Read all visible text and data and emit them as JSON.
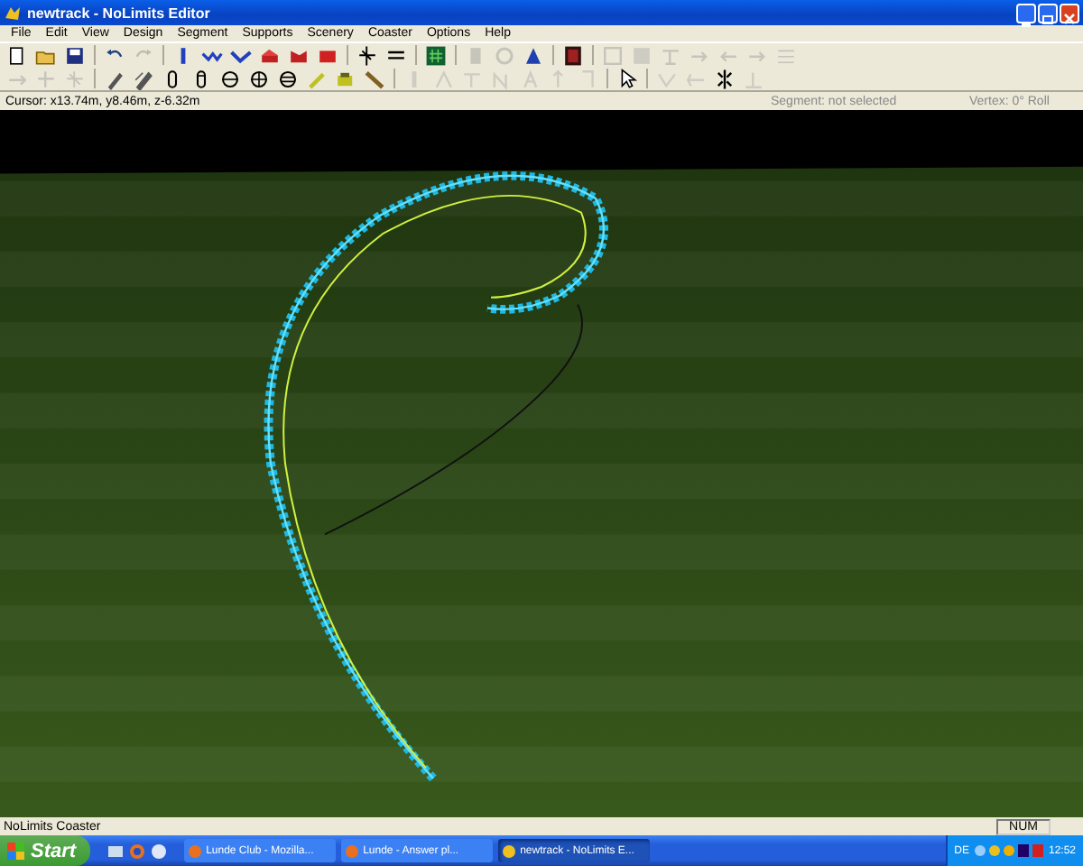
{
  "window": {
    "title": "newtrack - NoLimits Editor"
  },
  "menu": [
    "File",
    "Edit",
    "View",
    "Design",
    "Segment",
    "Supports",
    "Scenery",
    "Coaster",
    "Options",
    "Help"
  ],
  "toolbar_1": [
    {
      "disabled": false
    },
    {
      "disabled": false
    },
    {
      "disabled": false
    },
    {
      "disabled": false
    },
    {
      "disabled": true
    },
    {
      "disabled": false
    },
    {
      "disabled": false
    },
    {
      "disabled": false
    },
    {
      "disabled": false
    },
    {
      "disabled": false
    },
    {
      "disabled": false
    },
    {
      "disabled": false
    },
    {
      "disabled": false
    },
    {
      "disabled": false
    },
    {
      "disabled": true
    },
    {
      "disabled": true
    },
    {
      "disabled": false
    },
    {
      "disabled": false
    },
    {
      "disabled": true
    },
    {
      "disabled": true
    },
    {
      "disabled": true
    },
    {
      "disabled": true
    },
    {
      "disabled": true
    },
    {
      "disabled": true
    },
    {
      "disabled": true
    }
  ],
  "toolbar_2": [
    {
      "disabled": true
    },
    {
      "disabled": true
    },
    {
      "disabled": true
    },
    {
      "disabled": false
    },
    {
      "disabled": false
    },
    {
      "disabled": false
    },
    {
      "disabled": false
    },
    {
      "disabled": false
    },
    {
      "disabled": false
    },
    {
      "disabled": false
    },
    {
      "disabled": false
    },
    {
      "disabled": false
    },
    {
      "disabled": false
    },
    {
      "disabled": true
    },
    {
      "disabled": true
    },
    {
      "disabled": true
    },
    {
      "disabled": true
    },
    {
      "disabled": true
    },
    {
      "disabled": true
    },
    {
      "disabled": true
    },
    {
      "disabled": false
    },
    {
      "disabled": true
    },
    {
      "disabled": true
    },
    {
      "disabled": false
    },
    {
      "disabled": true
    }
  ],
  "info_bar": {
    "cursor": "Cursor: x13.74m, y8.46m, z-6.32m",
    "segment": "Segment: not selected",
    "vertex": "Vertex: 0° Roll"
  },
  "status_bar": {
    "text": "NoLimits Coaster",
    "num": "NUM"
  },
  "taskbar": {
    "start": "Start",
    "tasks": [
      {
        "label": "Lunde Club - Mozilla...",
        "selected": false
      },
      {
        "label": "Lunde - Answer pl...",
        "selected": false
      },
      {
        "label": "newtrack - NoLimits E...",
        "selected": true
      }
    ],
    "language": "DE",
    "clock": "12:52"
  }
}
